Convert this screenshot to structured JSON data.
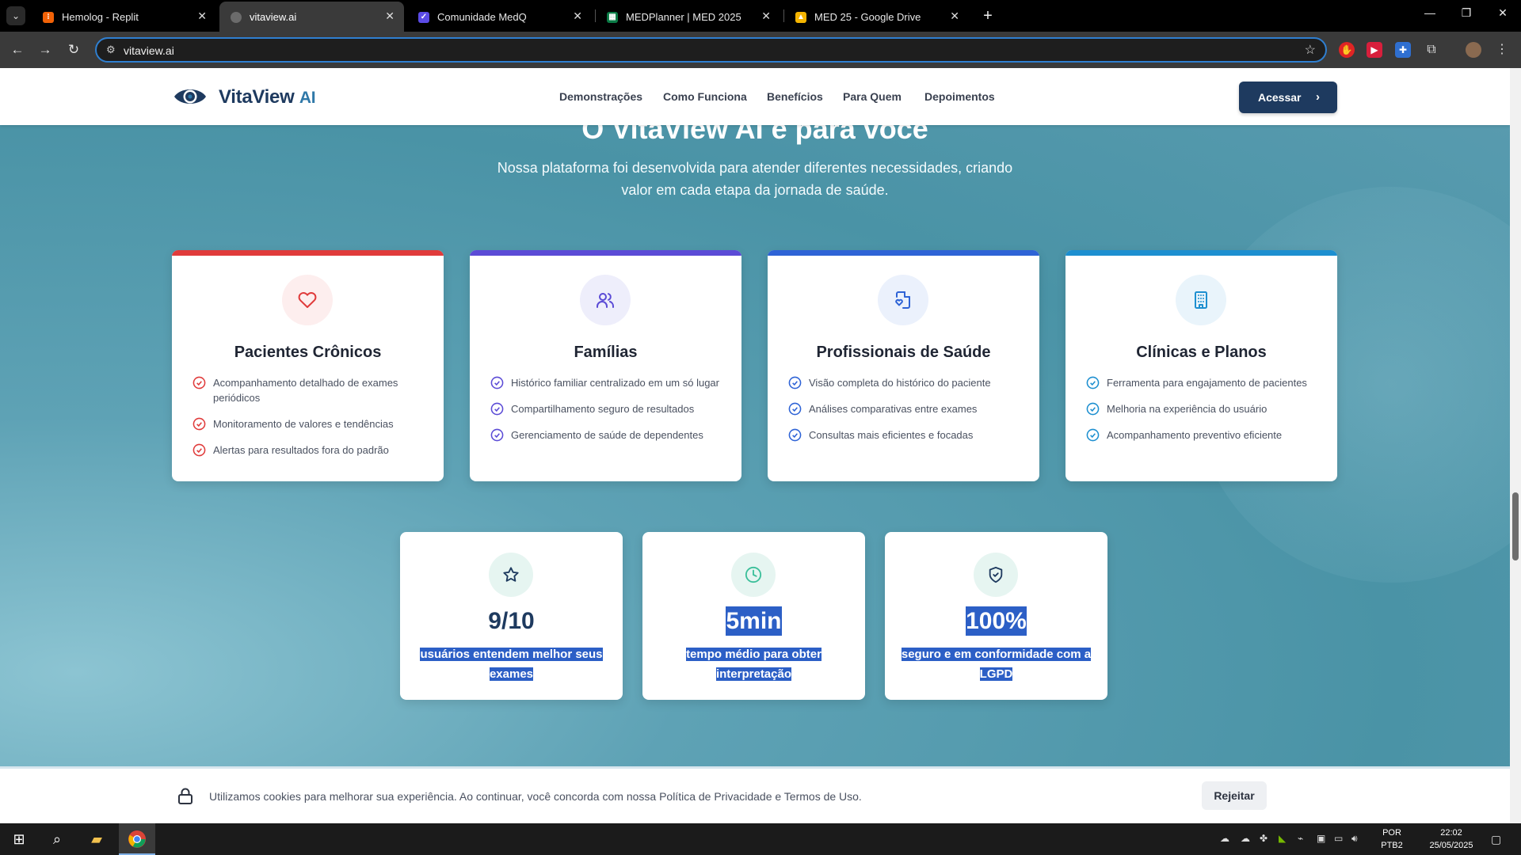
{
  "browser": {
    "tabs": [
      {
        "title": "Hemolog - Replit",
        "favicon_color": "#f26207",
        "active": false
      },
      {
        "title": "vitaview.ai",
        "favicon_color": "#6b6b6b",
        "active": true
      },
      {
        "title": "Comunidade MedQ",
        "favicon_color": "#5b4be6",
        "active": false
      },
      {
        "title": "MEDPlanner | MED 2025",
        "favicon_color": "#0a7a45",
        "active": false
      },
      {
        "title": "MED 25 - Google Drive",
        "favicon_color": "#f4b400",
        "active": false
      }
    ],
    "url": "vitaview.ai"
  },
  "site": {
    "logo_text": "VitaView",
    "logo_suffix": "AI",
    "nav_links": [
      "Demonstrações",
      "Como Funciona",
      "Benefícios",
      "Para Quem",
      "Depoimentos"
    ],
    "cta_label": "Acessar",
    "heading": "O VitaView AI é para você",
    "subtitle": "Nossa plataforma foi desenvolvida para atender diferentes necessidades, criando valor em cada etapa da jornada de saúde."
  },
  "audience_cards": [
    {
      "title": "Pacientes Crônicos",
      "icon": "heart-icon",
      "accent": "#e03b3b",
      "icon_bg": "#fdeeee",
      "items": [
        "Acompanhamento detalhado de exames periódicos",
        "Monitoramento de valores e tendências",
        "Alertas para resultados fora do padrão"
      ]
    },
    {
      "title": "Famílias",
      "icon": "users-icon",
      "accent": "#5b4bd6",
      "icon_bg": "#eeeefb",
      "items": [
        "Histórico familiar centralizado em um só lugar",
        "Compartilhamento seguro de resultados",
        "Gerenciamento de saúde de dependentes"
      ]
    },
    {
      "title": "Profissionais de Saúde",
      "icon": "file-heart-icon",
      "accent": "#2e63d6",
      "icon_bg": "#ebf1fc",
      "items": [
        "Visão completa do histórico do paciente",
        "Análises comparativas entre exames",
        "Consultas mais eficientes e focadas"
      ]
    },
    {
      "title": "Clínicas e Planos",
      "icon": "building-icon",
      "accent": "#1d8fd0",
      "icon_bg": "#e9f4fb",
      "items": [
        "Ferramenta para engajamento de pacientes",
        "Melhoria na experiência do usuário",
        "Acompanhamento preventivo eficiente"
      ]
    }
  ],
  "stats": [
    {
      "value": "9/10",
      "desc": "usuários entendem melhor seus exames",
      "icon": "star-icon",
      "icon_bg": "#e6f5f1",
      "value_selected": false
    },
    {
      "value": "5min",
      "desc": "tempo médio para obter interpretação",
      "icon": "clock-icon",
      "icon_bg": "#e6f5f1",
      "value_selected": true
    },
    {
      "value": "100%",
      "desc": "seguro e em conformidade com a LGPD",
      "icon": "shield-check-icon",
      "icon_bg": "#e6f5f1",
      "value_selected": true
    }
  ],
  "cookie": {
    "text": "Utilizamos cookies para melhorar sua experiência. Ao continuar, você concorda com nossa Política de Privacidade e Termos de Uso.",
    "reject_label": "Rejeitar"
  },
  "taskbar": {
    "lang": "POR",
    "lang_sub": "PTB2",
    "time": "22:02",
    "date": "25/05/2025"
  }
}
